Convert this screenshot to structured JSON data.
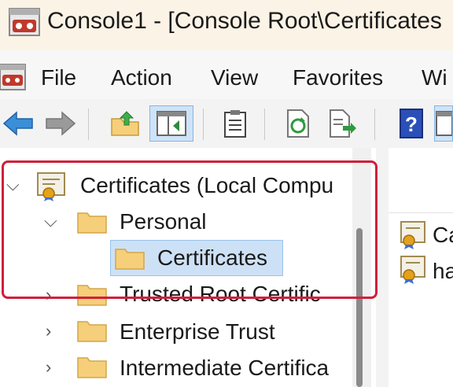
{
  "window": {
    "title": "Console1 - [Console Root\\Certificates"
  },
  "menu": {
    "items": [
      "File",
      "Action",
      "View",
      "Favorites",
      "Wi"
    ]
  },
  "toolbar": {
    "buttons": [
      "back-arrow",
      "forward-arrow",
      "up-folder",
      "show-hide-tree",
      "properties",
      "refresh",
      "export-list",
      "help",
      "show-hide-action"
    ]
  },
  "tree": {
    "root": "Certificates (Local Compu",
    "personal": "Personal",
    "certificates": "Certificates",
    "trusted_root": "Trusted Root Certific",
    "enterprise_trust": "Enterprise Trust",
    "intermediate": "Intermediate Certifica"
  },
  "list": {
    "items": [
      "Ca",
      "ha"
    ]
  },
  "colors": {
    "selection": "#cde1f6",
    "highlight_border": "#d0203a",
    "folder": "#f6cf7a"
  }
}
